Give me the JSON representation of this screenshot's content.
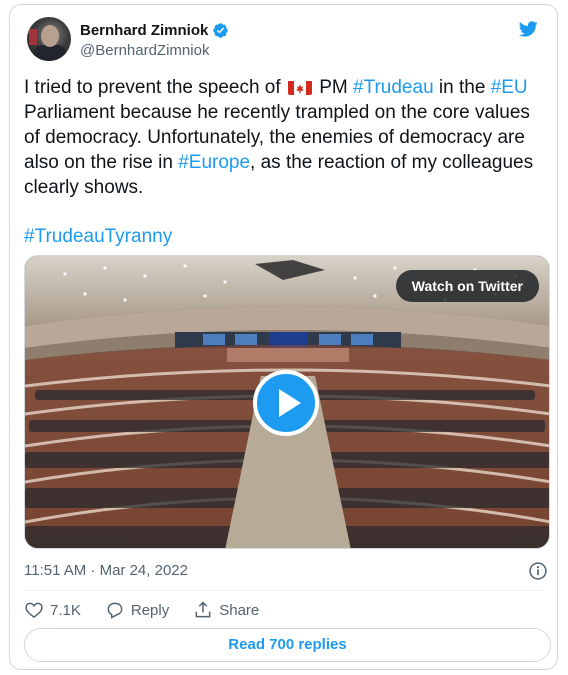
{
  "author": {
    "display_name": "Bernhard Zimniok",
    "handle": "@BernhardZimniok",
    "verified": true
  },
  "tweet": {
    "text_segments": [
      {
        "text": "I tried to prevent the speech of ",
        "type": "plain"
      },
      {
        "text": "flag-canada",
        "type": "emoji"
      },
      {
        "text": " PM ",
        "type": "plain"
      },
      {
        "text": "#Trudeau",
        "type": "link"
      },
      {
        "text": " in the ",
        "type": "plain"
      },
      {
        "text": "#EU",
        "type": "link"
      },
      {
        "text": " Parliament because he recently trampled on the core values of democracy. Unfortunately, the enemies of democracy are also on the rise in ",
        "type": "plain"
      },
      {
        "text": "#Europe",
        "type": "link"
      },
      {
        "text": ", as the reaction of my colleagues clearly shows.",
        "type": "plain"
      }
    ],
    "hashtag_line": "#TrudeauTyranny"
  },
  "media": {
    "watch_label": "Watch on Twitter",
    "play_icon": "play-icon"
  },
  "meta": {
    "timestamp": "11:51 AM · Mar 24, 2022",
    "info_icon": "info-icon"
  },
  "actions": {
    "likes_count": "7.1K",
    "reply_label": "Reply",
    "share_label": "Share"
  },
  "replies_button": "Read 700 replies",
  "colors": {
    "accent": "#1d9bf0",
    "like_red": "#f91880",
    "text_primary": "#0f1419",
    "text_secondary": "#536471",
    "border": "#cfd9de"
  }
}
